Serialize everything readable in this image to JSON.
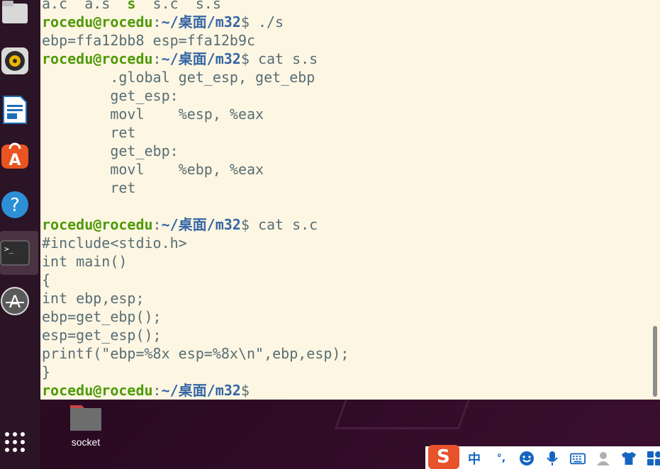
{
  "terminal": {
    "lines": [
      {
        "type": "ls",
        "text": "a.c  a.s  ",
        "exe": "s",
        "rest": "  s.c  s.s"
      },
      {
        "type": "prompt",
        "user": "rocedu@rocedu",
        "colon": ":",
        "path": "~/桌面/m32",
        "dollar": "$ ",
        "cmd": "./s"
      },
      {
        "type": "out",
        "text": "ebp=ffa12bb8 esp=ffa12b9c"
      },
      {
        "type": "prompt",
        "user": "rocedu@rocedu",
        "colon": ":",
        "path": "~/桌面/m32",
        "dollar": "$ ",
        "cmd": "cat s.s"
      },
      {
        "type": "out",
        "text": "        .global get_esp, get_ebp"
      },
      {
        "type": "out",
        "text": "        get_esp:"
      },
      {
        "type": "out",
        "text": "        movl    %esp, %eax"
      },
      {
        "type": "out",
        "text": "        ret"
      },
      {
        "type": "out",
        "text": "        get_ebp:"
      },
      {
        "type": "out",
        "text": "        movl    %ebp, %eax"
      },
      {
        "type": "out",
        "text": "        ret"
      },
      {
        "type": "out",
        "text": ""
      },
      {
        "type": "prompt",
        "user": "rocedu@rocedu",
        "colon": ":",
        "path": "~/桌面/m32",
        "dollar": "$ ",
        "cmd": "cat s.c"
      },
      {
        "type": "out",
        "text": "#include<stdio.h>"
      },
      {
        "type": "out",
        "text": "int main()"
      },
      {
        "type": "out",
        "text": "{"
      },
      {
        "type": "out",
        "text": "int ebp,esp;"
      },
      {
        "type": "out",
        "text": "ebp=get_ebp();"
      },
      {
        "type": "out",
        "text": "esp=get_esp();"
      },
      {
        "type": "out",
        "text": "printf(\"ebp=%8x esp=%8x\\n\",ebp,esp);"
      },
      {
        "type": "out",
        "text": "}"
      },
      {
        "type": "prompt",
        "user": "rocedu@rocedu",
        "colon": ":",
        "path": "~/桌面/m32",
        "dollar": "$",
        "cmd": ""
      }
    ]
  },
  "desktop": {
    "folder_label": "socket"
  },
  "dock": {
    "items": [
      "files-icon",
      "rhythmbox-icon",
      "writer-icon",
      "software-icon",
      "help-icon",
      "terminal-icon",
      "updater-icon"
    ],
    "apps_grid": "show-apps-icon"
  },
  "tray": {
    "ime_lang": "中",
    "ime_punct": "°,"
  },
  "colors": {
    "terminal_bg": "#fdf6e3",
    "user": "#4e9a06",
    "path": "#3465a4",
    "text": "#586e75"
  }
}
